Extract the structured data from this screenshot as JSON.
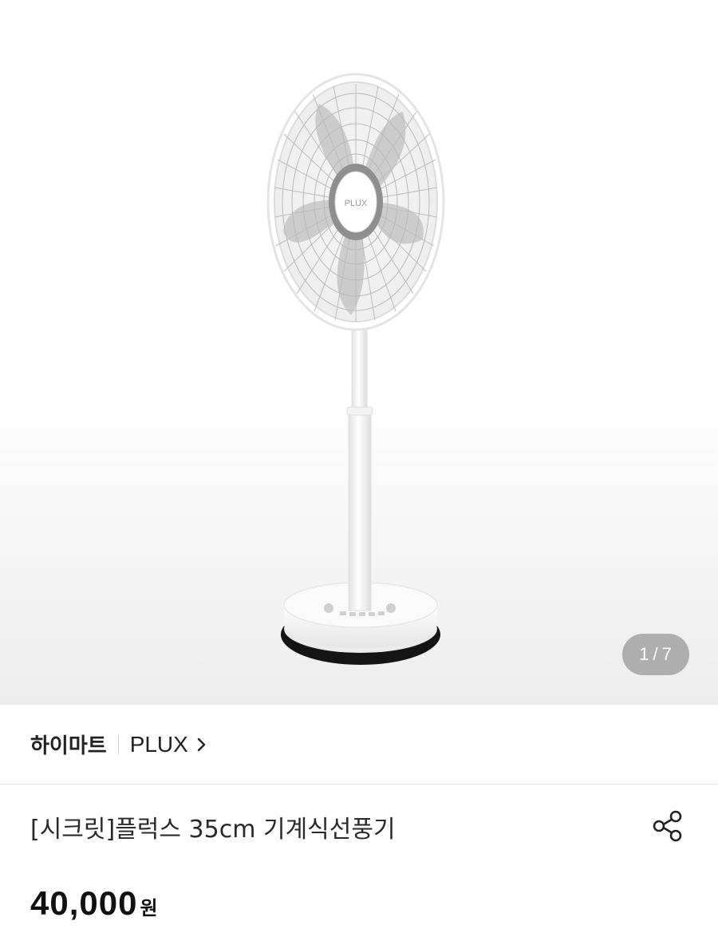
{
  "gallery": {
    "current_index": "1",
    "separator": "/",
    "total": "7",
    "product_logo": "PLUX"
  },
  "store": {
    "name": "하이마트",
    "brand": "PLUX",
    "brand_chevron": "chevron-right-icon"
  },
  "product": {
    "title": "[시크릿]플럭스 35cm 기계식선풍기",
    "share_icon": "share-icon"
  },
  "price": {
    "value": "40,000",
    "unit": "원"
  },
  "colors": {
    "text_primary": "#222222",
    "counter_bg": "#8a8a8a",
    "divider": "#e6e6e6"
  }
}
